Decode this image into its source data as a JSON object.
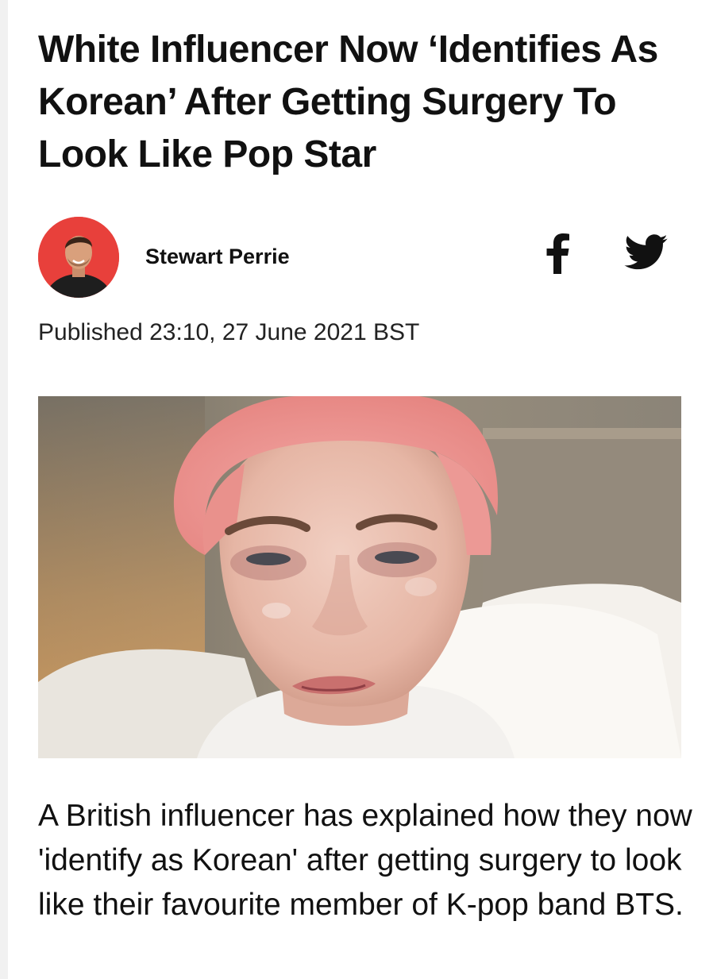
{
  "article": {
    "headline": "White Influencer Now ‘Identifies As Korean’ After Getting Surgery To Look Like Pop Star",
    "author": {
      "name": "Stewart Perrie",
      "avatar_background": "#e8403b"
    },
    "share": {
      "facebook_icon": "facebook-icon",
      "twitter_icon": "twitter-icon"
    },
    "published": "Published 23:10, 27 June 2021 BST",
    "lede": "A British influencer has explained how they now 'identify as Korean' after getting surgery to look like their favourite member of K-pop band BTS."
  }
}
